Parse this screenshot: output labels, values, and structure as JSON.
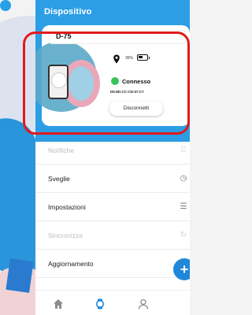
{
  "header": {
    "title": "Dispositivo"
  },
  "device_card": {
    "device_name": "D-75",
    "battery_percent": "36%",
    "status": "Connesso",
    "mac_address": "D5:8D:CC:CD:07:C7",
    "disconnect_label": "Disconnetti",
    "status_color": "#3bc35a"
  },
  "menu": {
    "items": [
      {
        "label": "Notifiche",
        "icon": "bell-icon",
        "enabled": false
      },
      {
        "label": "Sveglie",
        "icon": "clock-icon",
        "enabled": true
      },
      {
        "label": "Impostazioni",
        "icon": "sliders-icon",
        "enabled": true
      },
      {
        "label": "Sincronizza",
        "icon": "sync-icon",
        "enabled": false
      },
      {
        "label": "Aggiornamento",
        "icon": "upload-icon",
        "enabled": true
      }
    ]
  },
  "fab": {
    "label": "+"
  },
  "bottom_nav": {
    "items": [
      {
        "name": "home",
        "icon": "home-icon"
      },
      {
        "name": "watch",
        "icon": "watch-icon",
        "active": true
      },
      {
        "name": "profile",
        "icon": "user-icon"
      }
    ]
  },
  "colors": {
    "header": "#2c9ee5",
    "accent": "#1f88d8",
    "highlight": "#e11b1b"
  }
}
